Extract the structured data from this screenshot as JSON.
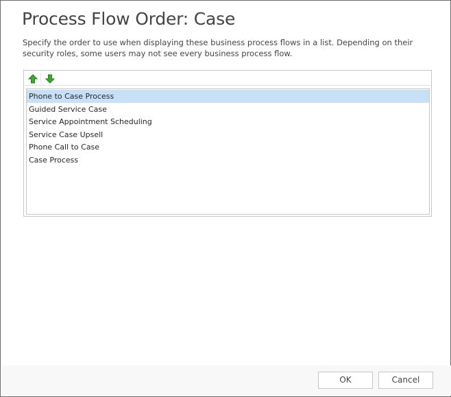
{
  "dialog": {
    "title": "Process Flow Order: Case",
    "description": "Specify the order to use when displaying these business process flows in a list. Depending on their security roles, some users may not see every business process flow."
  },
  "toolbar": {
    "move_up_icon": "arrow-up-icon",
    "move_down_icon": "arrow-down-icon",
    "arrow_color": "#3fa535",
    "arrow_outline": "#2b7a23"
  },
  "process_list": {
    "selected_color": "#c7dff7",
    "items": [
      {
        "label": "Phone to Case Process",
        "selected": true
      },
      {
        "label": "Guided Service Case",
        "selected": false
      },
      {
        "label": "Service Appointment Scheduling",
        "selected": false
      },
      {
        "label": "Service Case Upsell",
        "selected": false
      },
      {
        "label": "Phone Call to Case",
        "selected": false
      },
      {
        "label": "Case Process",
        "selected": false
      }
    ]
  },
  "footer": {
    "ok_label": "OK",
    "cancel_label": "Cancel"
  }
}
